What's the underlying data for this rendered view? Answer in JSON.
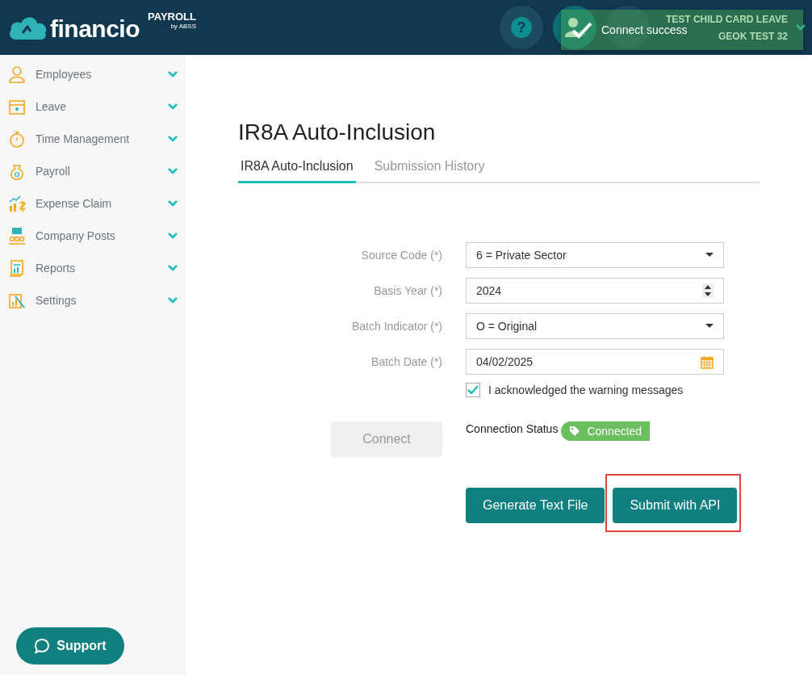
{
  "header": {
    "logo_text": "financio",
    "product": "PAYROLL",
    "vendor": "by ABSS",
    "help_glyph": "?",
    "account": {
      "line1": "TEST CHILD CARD LEAVE",
      "line2": "GEOK TEST 32"
    }
  },
  "toast": {
    "message": "Connect success"
  },
  "sidebar": {
    "items": [
      {
        "label": "Employees",
        "kind": "person"
      },
      {
        "label": "Leave",
        "kind": "calendar"
      },
      {
        "label": "Time Management",
        "kind": "stopwatch"
      },
      {
        "label": "Payroll",
        "kind": "moneybag"
      },
      {
        "label": "Expense Claim",
        "kind": "chart"
      },
      {
        "label": "Company Posts",
        "kind": "people"
      },
      {
        "label": "Reports",
        "kind": "report"
      },
      {
        "label": "Settings",
        "kind": "wand"
      }
    ]
  },
  "support_button": "Support",
  "page": {
    "title": "IR8A Auto-Inclusion",
    "tabs": [
      {
        "label": "IR8A Auto-Inclusion",
        "selected": true
      },
      {
        "label": "Submission History",
        "selected": false
      }
    ],
    "fields": [
      {
        "label": "Source Code (*)",
        "kind": "select",
        "value": "6 = Private Sector"
      },
      {
        "label": "Basis Year (*)",
        "kind": "number",
        "value": "2024"
      },
      {
        "label": "Batch Indicator (*)",
        "kind": "select",
        "value": "O = Original"
      },
      {
        "label": "Batch Date (*)",
        "kind": "date",
        "value": "04/02/2025"
      }
    ],
    "acknowledge": {
      "label": "I acknowledged the warning messages",
      "checked": true
    },
    "connect_button": {
      "label": "Connect",
      "disabled": true
    },
    "connection_status": {
      "label": "Connection Status",
      "badge": "Connected"
    },
    "actions": [
      {
        "label": "Generate Text File",
        "highlighted": false
      },
      {
        "label": "Submit with API",
        "highlighted": true
      }
    ]
  }
}
